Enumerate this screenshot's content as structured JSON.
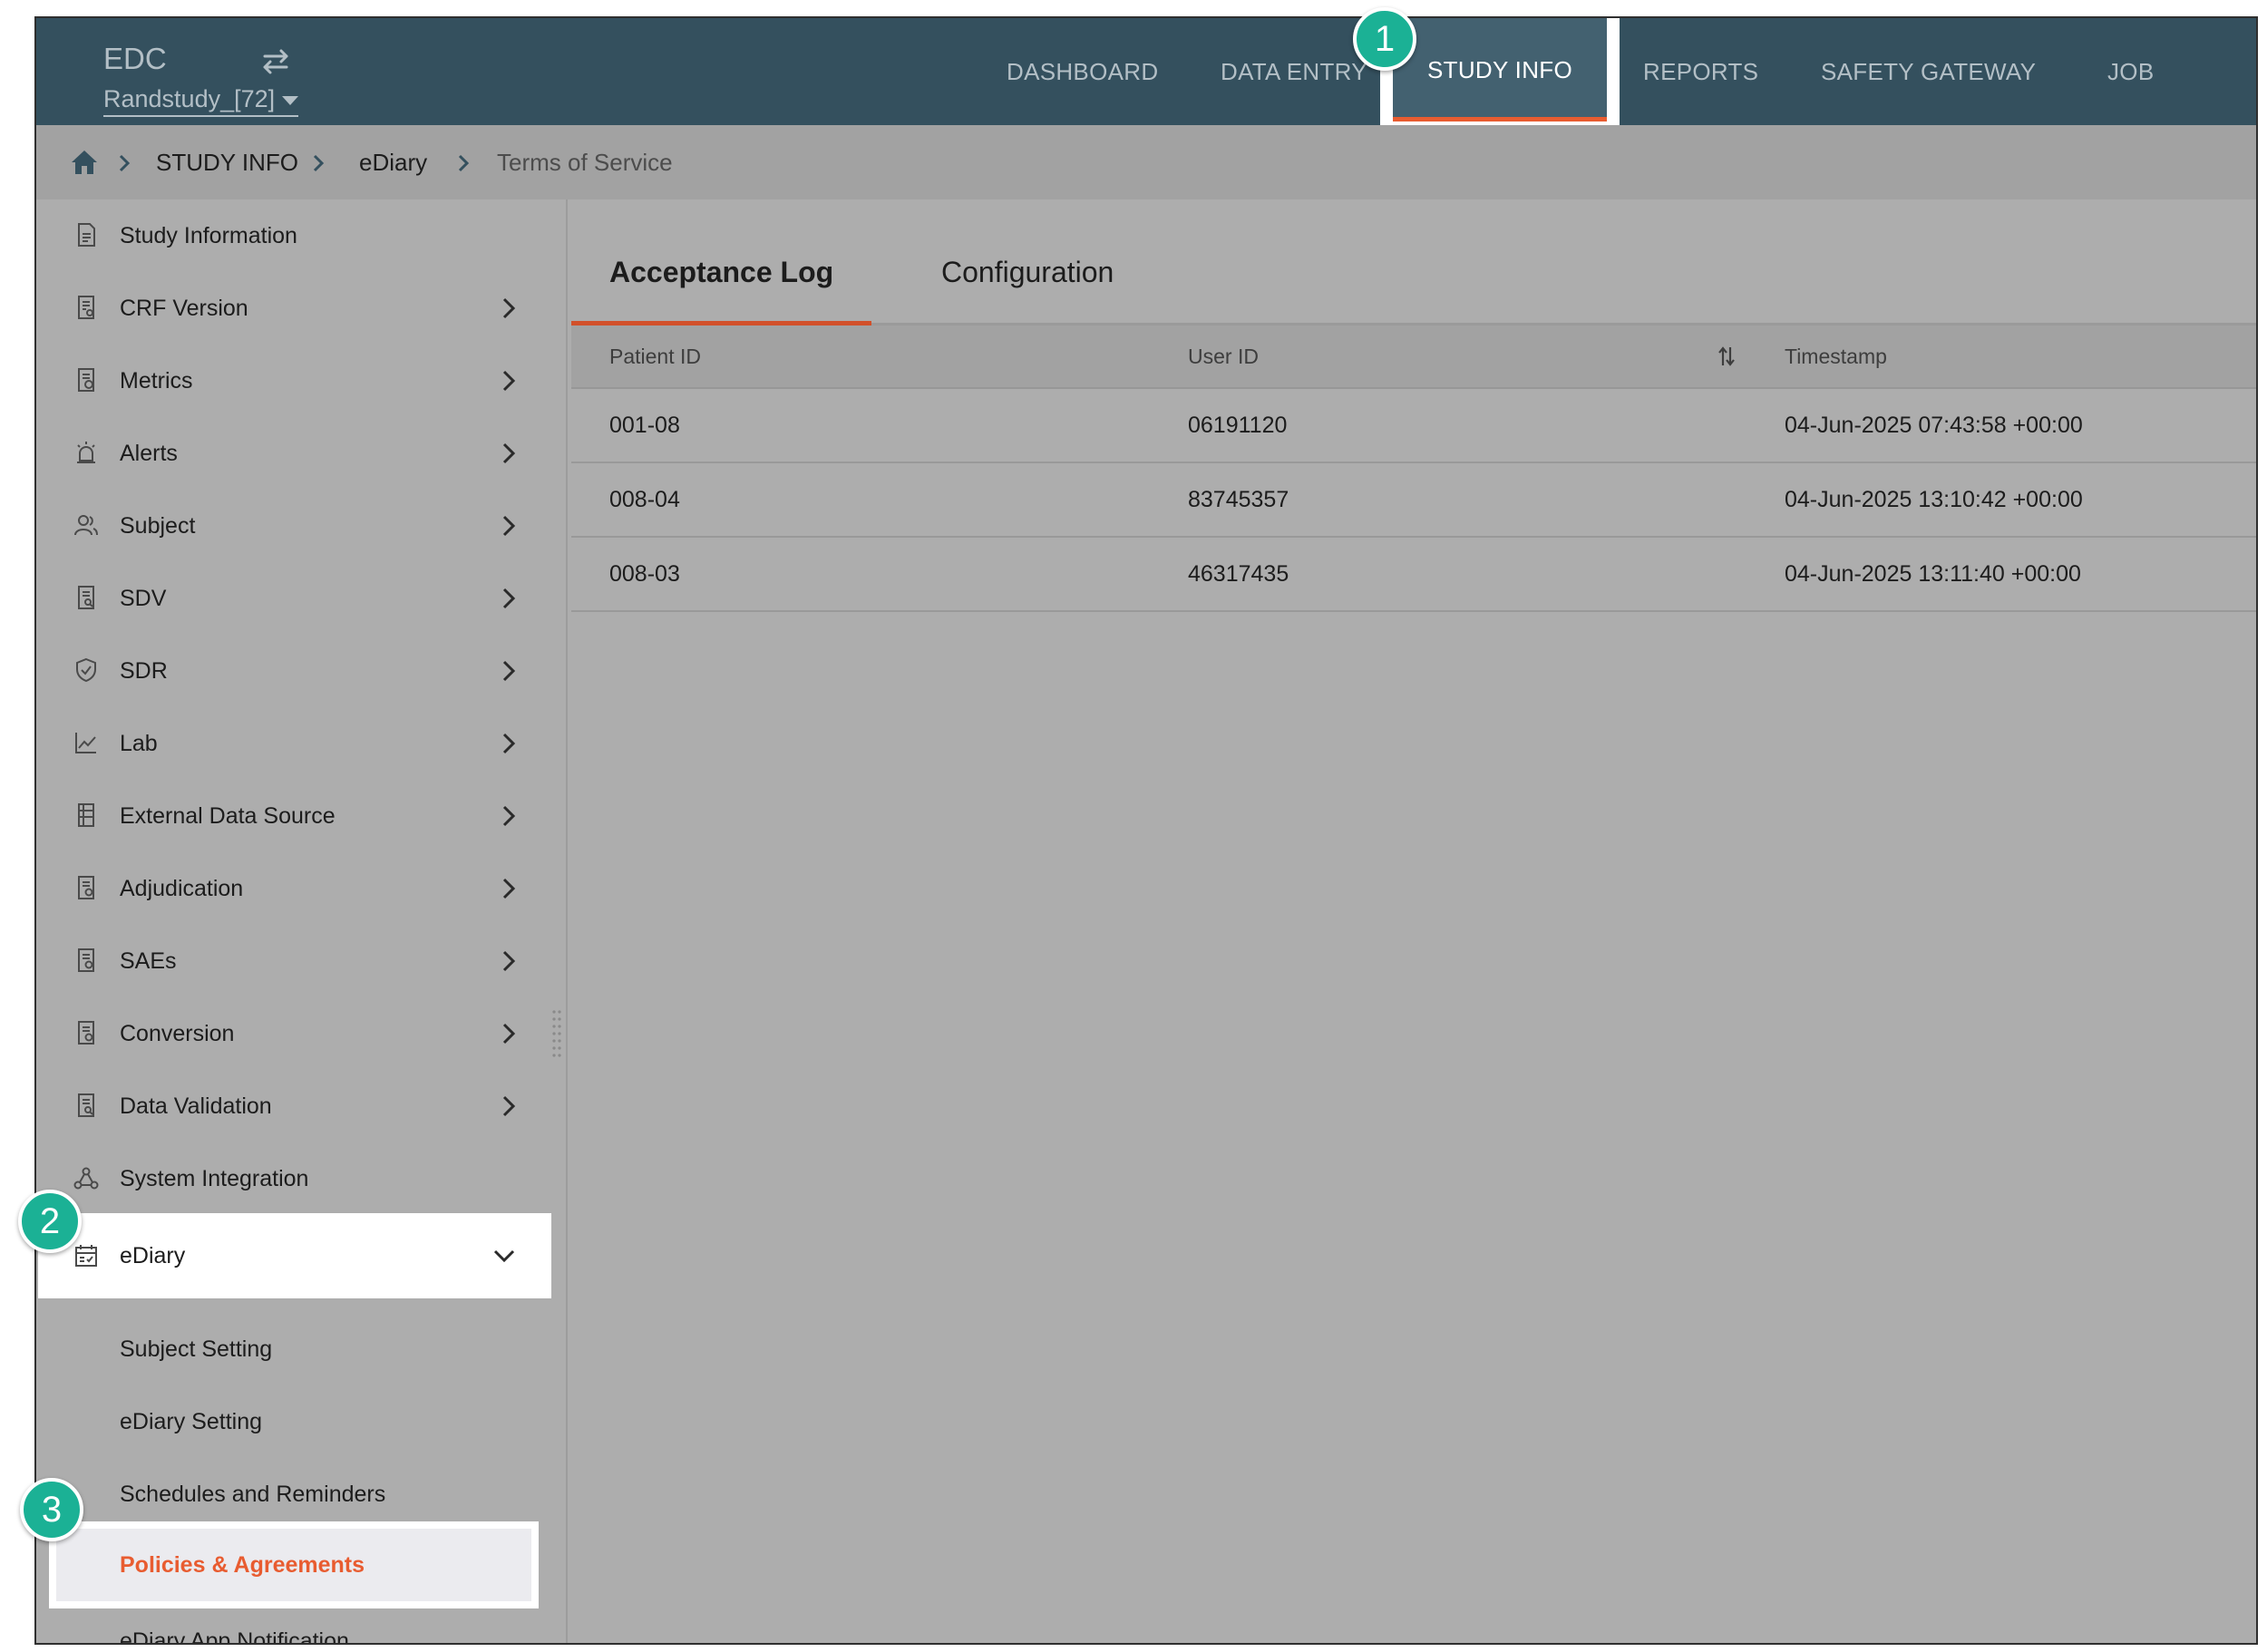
{
  "header": {
    "app_name": "EDC",
    "study_selector": "Randstudy_[72]",
    "nav": [
      {
        "label": "DASHBOARD"
      },
      {
        "label": "DATA ENTRY"
      },
      {
        "label": "STUDY INFO",
        "active": true
      },
      {
        "label": "REPORTS"
      },
      {
        "label": "SAFETY GATEWAY"
      },
      {
        "label": "JOB"
      }
    ]
  },
  "breadcrumb": {
    "items": [
      "STUDY INFO",
      "eDiary",
      "Terms of Service"
    ]
  },
  "sidebar": {
    "items": [
      {
        "label": "Study Information",
        "icon": "document-icon"
      },
      {
        "label": "CRF Version",
        "icon": "form-icon"
      },
      {
        "label": "Metrics",
        "icon": "metrics-icon"
      },
      {
        "label": "Alerts",
        "icon": "alarm-icon"
      },
      {
        "label": "Subject",
        "icon": "people-icon"
      },
      {
        "label": "SDV",
        "icon": "search-doc-icon"
      },
      {
        "label": "SDR",
        "icon": "shield-check-icon"
      },
      {
        "label": "Lab",
        "icon": "line-chart-icon"
      },
      {
        "label": "External Data Source",
        "icon": "database-icon"
      },
      {
        "label": "Adjudication",
        "icon": "doc-gear-icon"
      },
      {
        "label": "SAEs",
        "icon": "doc-gear-icon"
      },
      {
        "label": "Conversion",
        "icon": "doc-gear-icon"
      },
      {
        "label": "Data Validation",
        "icon": "search-doc-icon"
      },
      {
        "label": "System Integration",
        "icon": "network-icon"
      },
      {
        "label": "eDiary",
        "icon": "calendar-icon",
        "expanded": true
      }
    ],
    "ediary_sub": [
      {
        "label": "Subject Setting"
      },
      {
        "label": "eDiary Setting"
      },
      {
        "label": "Schedules and Reminders"
      },
      {
        "label": "Policies & Agreements",
        "active": true
      },
      {
        "label": "eDiary App Notification"
      }
    ]
  },
  "main": {
    "tabs": [
      {
        "label": "Acceptance Log",
        "active": true
      },
      {
        "label": "Configuration"
      }
    ],
    "table": {
      "columns": [
        "Patient ID",
        "User ID",
        "Timestamp"
      ],
      "rows": [
        [
          "001-08",
          "06191120",
          "04-Jun-2025 07:43:58 +00:00"
        ],
        [
          "008-04",
          "83745357",
          "04-Jun-2025 13:10:42 +00:00"
        ],
        [
          "008-03",
          "46317435",
          "04-Jun-2025 13:11:40 +00:00"
        ]
      ]
    }
  },
  "annotations": [
    "1",
    "2",
    "3"
  ],
  "colors": {
    "topbar": "#34505e",
    "active_tab_bg": "#436170",
    "accent": "#e85c30",
    "badge": "#1bb195",
    "overlay_gray": "#adadad"
  }
}
